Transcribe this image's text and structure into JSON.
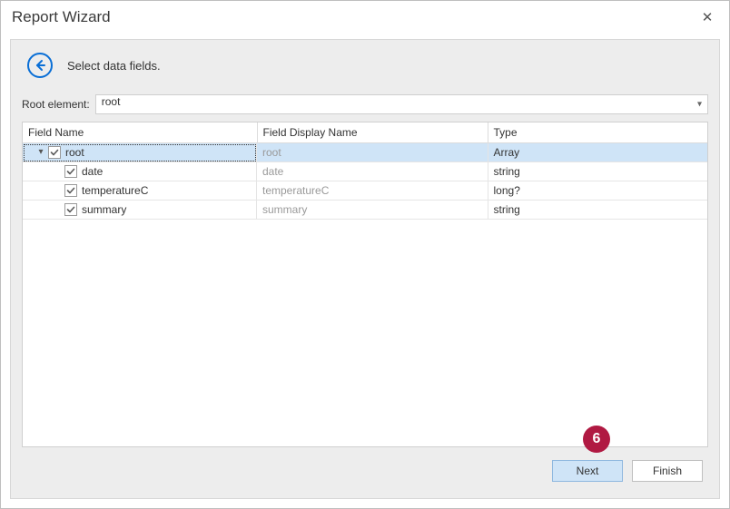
{
  "window": {
    "title": "Report Wizard"
  },
  "heading": "Select data fields.",
  "rootRow": {
    "label": "Root element:",
    "value": "root"
  },
  "columns": {
    "name": "Field Name",
    "display": "Field Display Name",
    "type": "Type"
  },
  "rows": [
    {
      "level": 0,
      "expander": "▾",
      "checked": true,
      "name": "root",
      "display": "root",
      "type": "Array",
      "selected": true
    },
    {
      "level": 1,
      "expander": "",
      "checked": true,
      "name": "date",
      "display": "date",
      "type": "string",
      "selected": false
    },
    {
      "level": 1,
      "expander": "",
      "checked": true,
      "name": "temperatureC",
      "display": "temperatureC",
      "type": "long?",
      "selected": false
    },
    {
      "level": 1,
      "expander": "",
      "checked": true,
      "name": "summary",
      "display": "summary",
      "type": "string",
      "selected": false
    }
  ],
  "buttons": {
    "next": "Next",
    "finish": "Finish"
  },
  "badge": "6",
  "colWidths": {
    "name": 258,
    "display": 254,
    "type": 250
  }
}
